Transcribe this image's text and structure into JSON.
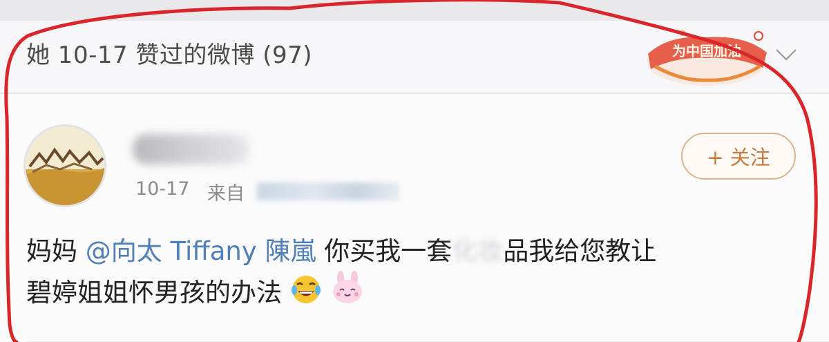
{
  "liked_section": {
    "title": "她 10-17 赞过的微博 (97)",
    "badge_text": "为中国加油"
  },
  "post": {
    "meta": {
      "date": "10-17",
      "from_label": "来自"
    },
    "follow_label": "+ 关注",
    "text": {
      "line1_prefix": "妈妈 ",
      "mention": "@向太 Tiffany 陳嵐",
      "line1_mid": " 你买我一套",
      "blurred": "化妆",
      "line1_suffix": "品我给您教让",
      "line2": "碧婷姐姐怀男孩的办法"
    },
    "emojis": [
      "laugh-cry-emoji",
      "pink-bunny-emoji"
    ]
  },
  "colors": {
    "annotation_red": "#d9262b",
    "mention_blue": "#4f7fb8",
    "follow_orange": "#c9773a"
  }
}
